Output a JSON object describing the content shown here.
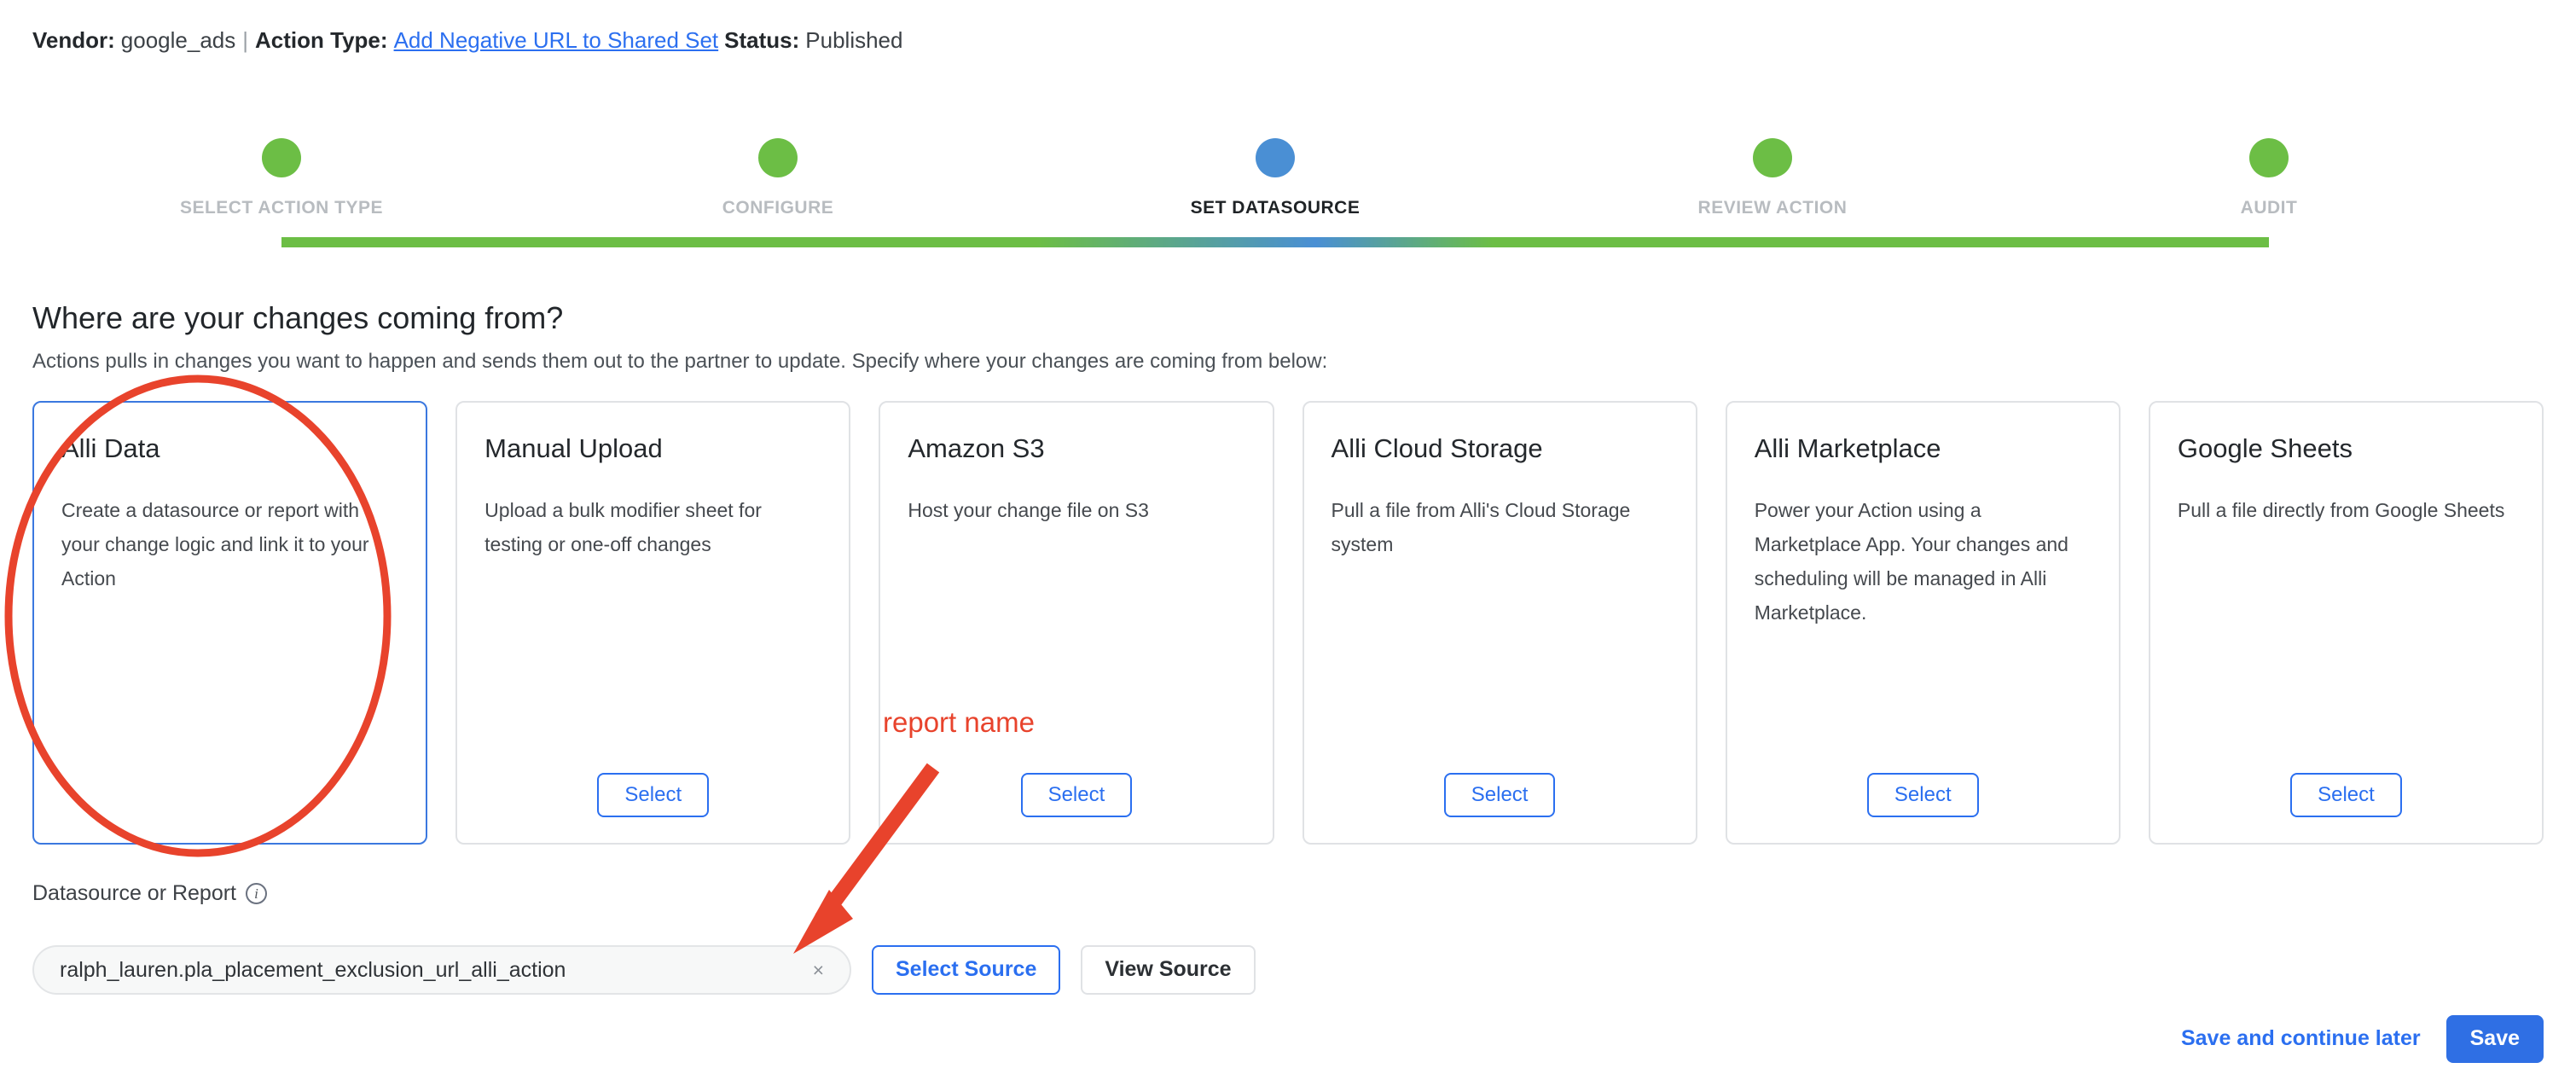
{
  "header": {
    "vendor_label": "Vendor:",
    "vendor_value": "google_ads",
    "divider": "|",
    "action_type_label": "Action Type:",
    "action_type_value": "Add Negative URL to Shared Set",
    "status_label": "Status:",
    "status_value": "Published",
    "link_color": "#2b6ff0"
  },
  "stepper": {
    "colors": {
      "done": "#6cbe45",
      "current": "#4a8fd4"
    },
    "steps": [
      {
        "label": "SELECT ACTION TYPE",
        "state": "done"
      },
      {
        "label": "CONFIGURE",
        "state": "done"
      },
      {
        "label": "SET DATASOURCE",
        "state": "current"
      },
      {
        "label": "REVIEW ACTION",
        "state": "done"
      },
      {
        "label": "AUDIT",
        "state": "done"
      }
    ]
  },
  "section": {
    "title": "Where are your changes coming from?",
    "subtitle": "Actions pulls in changes you want to happen and sends them out to the partner to update. Specify where your changes are coming from below:"
  },
  "cards": [
    {
      "title": "Alli Data",
      "description": "Create a datasource or report with your change logic and link it to your Action",
      "selected": true,
      "has_select_button": false,
      "select_label": ""
    },
    {
      "title": "Manual Upload",
      "description": "Upload a bulk modifier sheet for testing or one-off changes",
      "selected": false,
      "has_select_button": true,
      "select_label": "Select"
    },
    {
      "title": "Amazon S3",
      "description": "Host your change file on S3",
      "selected": false,
      "has_select_button": true,
      "select_label": "Select"
    },
    {
      "title": "Alli Cloud Storage",
      "description": "Pull a file from Alli's Cloud Storage system",
      "selected": false,
      "has_select_button": true,
      "select_label": "Select"
    },
    {
      "title": "Alli Marketplace",
      "description": "Power your Action using a Marketplace App. Your changes and scheduling will be managed in Alli Marketplace.",
      "selected": false,
      "has_select_button": true,
      "select_label": "Select"
    },
    {
      "title": "Google Sheets",
      "description": "Pull a file directly from Google Sheets",
      "selected": false,
      "has_select_button": true,
      "select_label": "Select"
    }
  ],
  "datasource": {
    "label": "Datasource or Report",
    "info_icon": "info-icon",
    "chip_value": "ralph_lauren.pla_placement_exclusion_url_alli_action",
    "chip_remove_icon": "×",
    "select_source_label": "Select Source",
    "view_source_label": "View Source"
  },
  "footer": {
    "save_and_continue_label": "Save and continue later",
    "save_label": "Save",
    "primary_color": "#2f6fe4"
  },
  "annotations": {
    "color": "#e8432c",
    "report_name_text": "report name",
    "ellipse_target": "alli-data-card",
    "arrow_points_to": "datasource-chip"
  }
}
